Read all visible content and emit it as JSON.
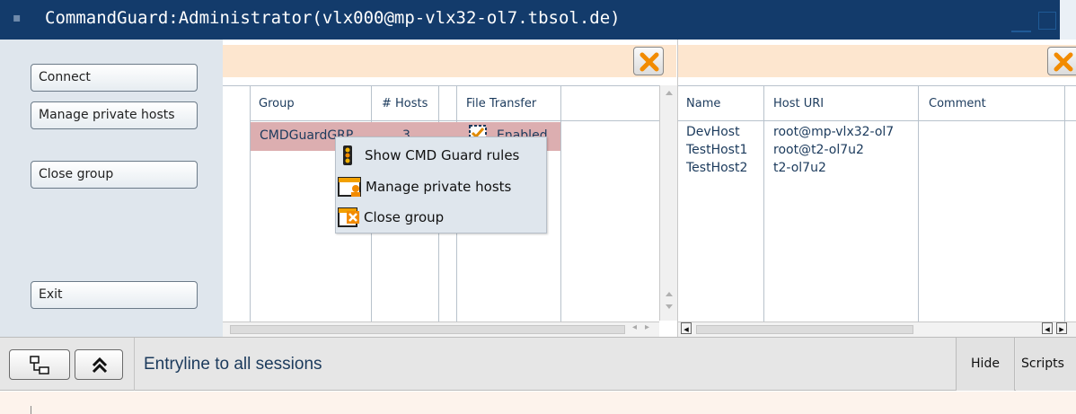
{
  "window": {
    "title": "CommandGuard:Administrator(vlx000@mp-vlx32-ol7.tbsol.de)"
  },
  "sidebar": {
    "connect": "Connect",
    "manage_private_hosts": "Manage private hosts",
    "close_group": "Close group",
    "exit": "Exit"
  },
  "groups_table": {
    "columns": [
      "Group",
      "# Hosts",
      "File Transfer"
    ],
    "rows": [
      {
        "group": "CMDGuardGRP",
        "hosts": "3",
        "file_transfer": "Enabled"
      }
    ]
  },
  "hosts_table": {
    "columns": [
      "Name",
      "Host URI",
      "Comment"
    ],
    "rows": [
      {
        "name": "DevHost",
        "uri": "root@mp-vlx32-ol7",
        "comment": ""
      },
      {
        "name": "TestHost1",
        "uri": "root@t2-ol7u2",
        "comment": ""
      },
      {
        "name": "TestHost2",
        "uri": "t2-ol7u2",
        "comment": ""
      }
    ]
  },
  "context_menu": {
    "items": [
      {
        "label": "Show CMD Guard rules",
        "icon": "traffic-light-icon"
      },
      {
        "label": "Manage private hosts",
        "icon": "window-user-icon"
      },
      {
        "label": "Close group",
        "icon": "close-window-icon"
      }
    ]
  },
  "bottom": {
    "entryline_label": "Entryline to all sessions",
    "hide_button": "Hide",
    "scripts_button": "Scripts"
  },
  "colors": {
    "titlebar": "#133b6b",
    "selected_row": "#dcaeb0",
    "orange_bar": "#fde6cf",
    "close_x": "#f28b00"
  }
}
